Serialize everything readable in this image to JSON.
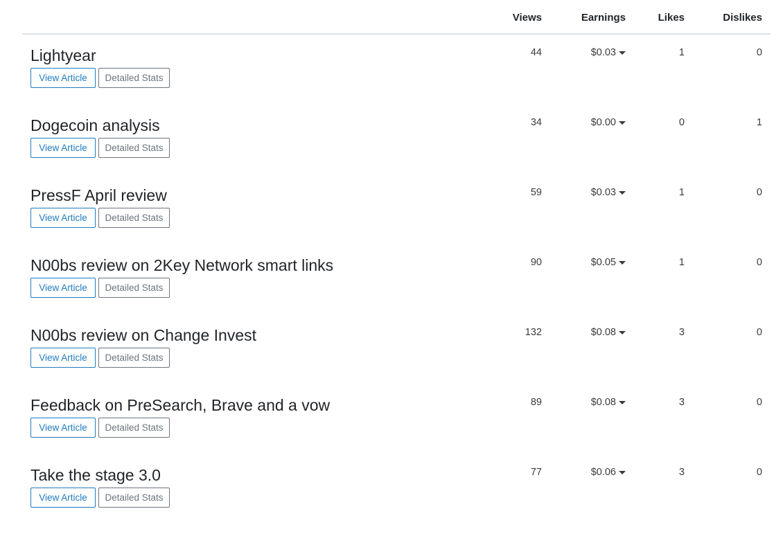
{
  "table": {
    "columns": {
      "views": "Views",
      "earnings": "Earnings",
      "likes": "Likes",
      "dislikes": "Dislikes"
    },
    "view_label": "View Article",
    "stats_label": "Detailed Stats",
    "dropdown_icon": "caret-down-icon",
    "rows": [
      {
        "title": "Lightyear",
        "views": "44",
        "earnings": "$0.03",
        "likes": "1",
        "dislikes": "0"
      },
      {
        "title": "Dogecoin analysis",
        "views": "34",
        "earnings": "$0.00",
        "likes": "0",
        "dislikes": "1"
      },
      {
        "title": "PressF April review",
        "views": "59",
        "earnings": "$0.03",
        "likes": "1",
        "dislikes": "0"
      },
      {
        "title": "N00bs review on 2Key Network smart links",
        "views": "90",
        "earnings": "$0.05",
        "likes": "1",
        "dislikes": "0"
      },
      {
        "title": "N00bs review on Change Invest",
        "views": "132",
        "earnings": "$0.08",
        "likes": "3",
        "dislikes": "0"
      },
      {
        "title": "Feedback on PreSearch, Brave and a vow",
        "views": "89",
        "earnings": "$0.08",
        "likes": "3",
        "dislikes": "0"
      },
      {
        "title": "Take the stage 3.0",
        "views": "77",
        "earnings": "$0.06",
        "likes": "3",
        "dislikes": "0"
      }
    ]
  }
}
